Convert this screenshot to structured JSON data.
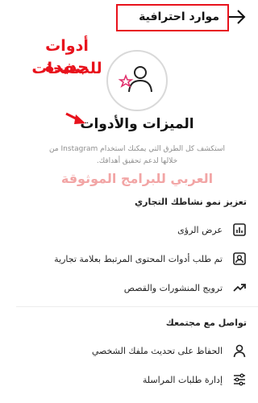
{
  "header": {
    "title": "موارد احترافية"
  },
  "annotation": {
    "line1": "أدوات جديدة",
    "line2": "للصفحات"
  },
  "hero": {
    "title": "الميزات والأدوات",
    "description": "استكشف كل الطرق التي يمكنك استخدام Instagram من خلالها لدعم تحقيق أهدافك."
  },
  "watermark": "العربي للبرامج الموثوقة",
  "sections": [
    {
      "title": "تعزيز نمو نشاطك التجاري",
      "items": [
        {
          "label": "عرض الرؤى",
          "icon": "insights-bar-chart-icon"
        },
        {
          "label": "تم طلب أدوات المحتوى المرتبط بعلامة تجارية",
          "icon": "branded-content-icon"
        },
        {
          "label": "ترويج المنشورات والقصص",
          "icon": "trending-up-icon"
        }
      ]
    },
    {
      "title": "تواصل مع مجتمعك",
      "items": [
        {
          "label": "الحفاظ على تحديث ملفك الشخصي",
          "icon": "profile-person-icon"
        },
        {
          "label": "إدارة طلبات المراسلة",
          "icon": "message-requests-sliders-icon"
        }
      ]
    }
  ],
  "colors": {
    "annotation_red": "#e8121c",
    "accent_star": "#e1306c",
    "muted_text": "#8e8e8e"
  }
}
